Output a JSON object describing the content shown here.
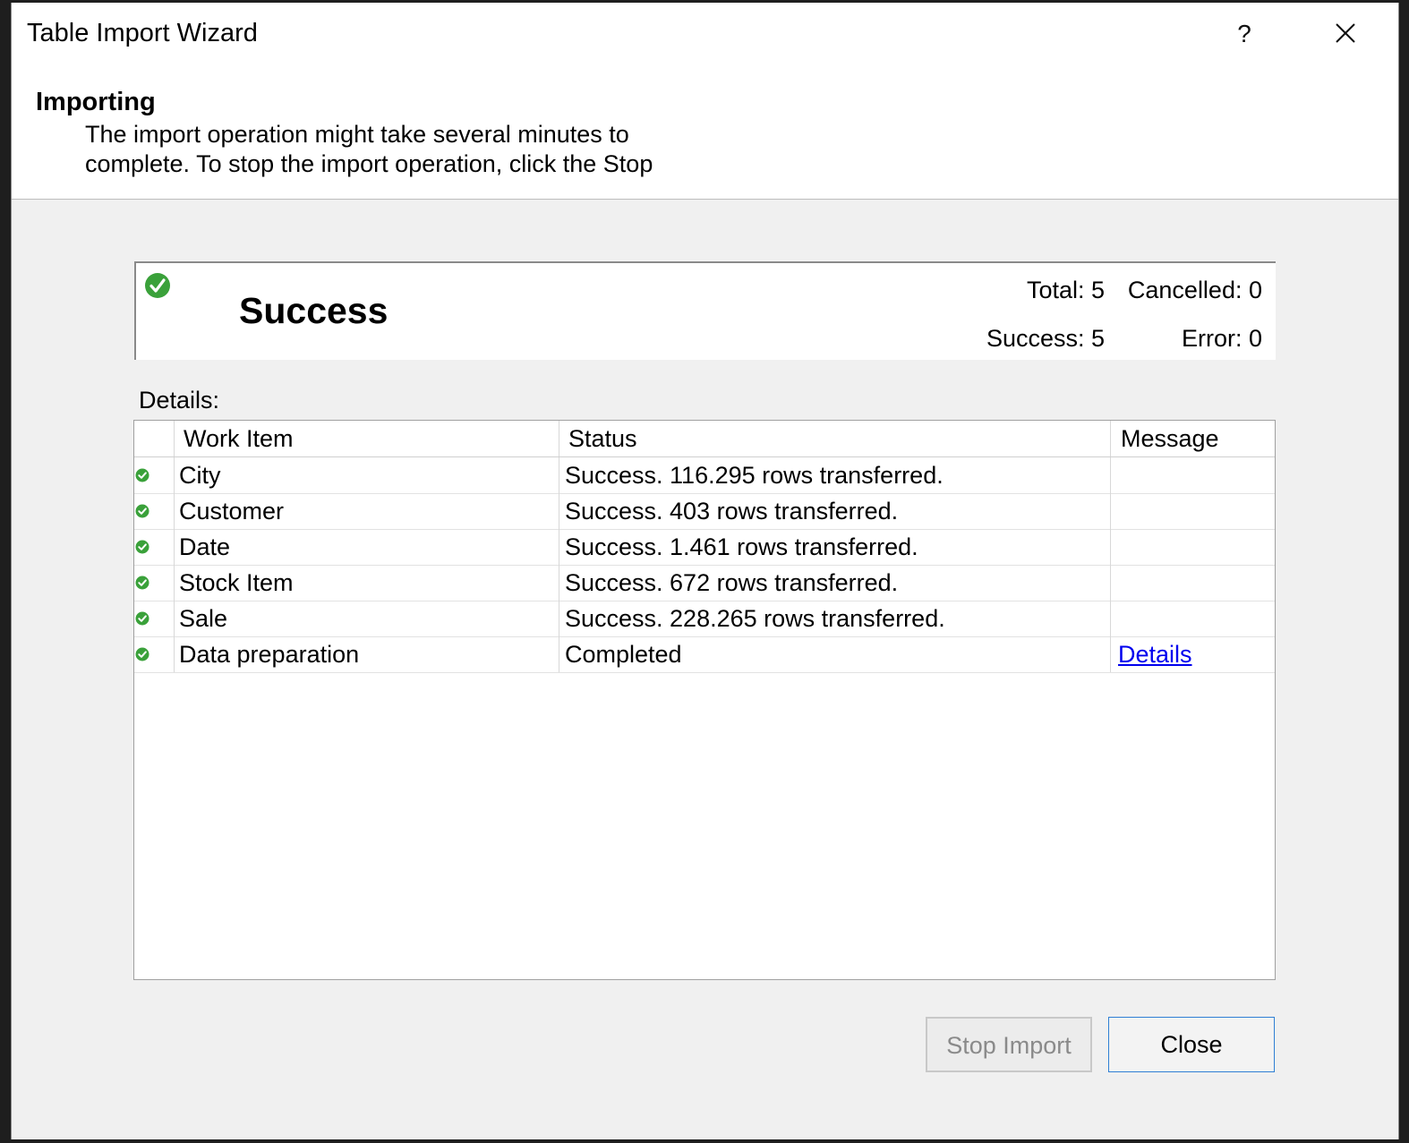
{
  "window": {
    "title": "Table Import Wizard",
    "help_label": "?",
    "close_icon": "close-icon"
  },
  "header": {
    "heading": "Importing",
    "description": "The import operation might take several minutes to complete. To stop the import operation, click the Stop"
  },
  "summary": {
    "status": "Success",
    "status_icon": "success-check-icon",
    "total": "Total: 5",
    "cancelled": "Cancelled: 0",
    "success": "Success: 5",
    "error": "Error: 0"
  },
  "details": {
    "label": "Details:",
    "columns": [
      "",
      "Work Item",
      "Status",
      "Message"
    ],
    "rows": [
      {
        "icon": "success-check-icon",
        "work_item": "City",
        "status": "Success. 116.295 rows transferred.",
        "message": ""
      },
      {
        "icon": "success-check-icon",
        "work_item": "Customer",
        "status": "Success. 403 rows transferred.",
        "message": ""
      },
      {
        "icon": "success-check-icon",
        "work_item": "Date",
        "status": "Success. 1.461 rows transferred.",
        "message": ""
      },
      {
        "icon": "success-check-icon",
        "work_item": "Stock Item",
        "status": "Success. 672 rows transferred.",
        "message": ""
      },
      {
        "icon": "success-check-icon",
        "work_item": "Sale",
        "status": "Success. 228.265 rows transferred.",
        "message": ""
      },
      {
        "icon": "success-check-icon",
        "work_item": "Data preparation",
        "status": "Completed",
        "message": "Details"
      }
    ]
  },
  "buttons": {
    "stop_import": "Stop Import",
    "close": "Close"
  },
  "colors": {
    "success_green": "#3aa13a",
    "link_blue": "#0000ee",
    "focus_border": "#2f7fd4"
  }
}
